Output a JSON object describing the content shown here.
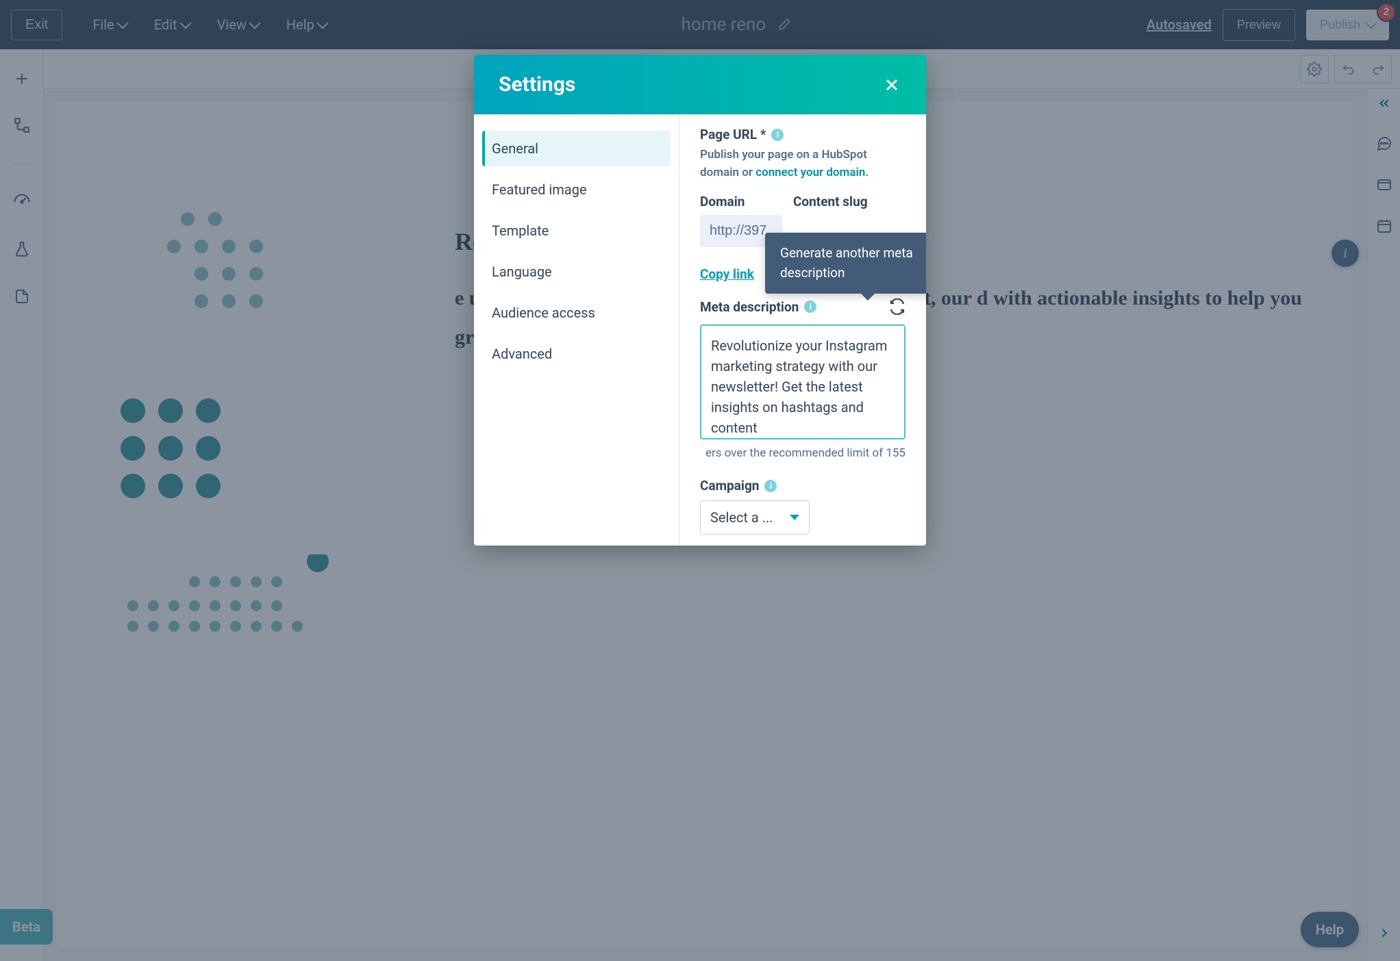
{
  "topbar": {
    "exit": "Exit",
    "menu": [
      "File",
      "Edit",
      "View",
      "Help"
    ],
    "title": "home reno",
    "autosaved": "Autosaved",
    "preview": "Preview",
    "publish": "Publish",
    "badge": "2"
  },
  "leftrail": {
    "icons": [
      "plus",
      "tree",
      "gauge",
      "flask",
      "file"
    ]
  },
  "rightrail": {
    "icons": [
      "collapse",
      "chat",
      "panel",
      "calendar"
    ]
  },
  "page": {
    "heading_fragment": "Revolution!",
    "body": "e up your rategy? Look no tter! From the to tips for nt, our d with actionable insights to help you grow your following and increase engagement."
  },
  "modal": {
    "title": "Settings",
    "nav": [
      "General",
      "Featured image",
      "Template",
      "Language",
      "Audience access",
      "Advanced"
    ],
    "active_nav": "General",
    "page_url": {
      "label": "Page URL *",
      "help_prefix": "Publish your page on a HubSpot domain or ",
      "help_link": "connect your domain.",
      "domain_label": "Domain",
      "domain_value": "http://397",
      "slug_label": "Content slug"
    },
    "copy_link": "Copy link",
    "meta": {
      "label": "Meta description",
      "value": "Revolutionize your Instagram marketing strategy with our newsletter! Get the latest insights on hashtags and content",
      "limit_text": "ers over the recommended limit of 155"
    },
    "campaign": {
      "label": "Campaign",
      "select": "Select a ..."
    },
    "tooltip": "Generate another meta description"
  },
  "floats": {
    "info": "i",
    "help": "Help",
    "beta": "Beta"
  }
}
